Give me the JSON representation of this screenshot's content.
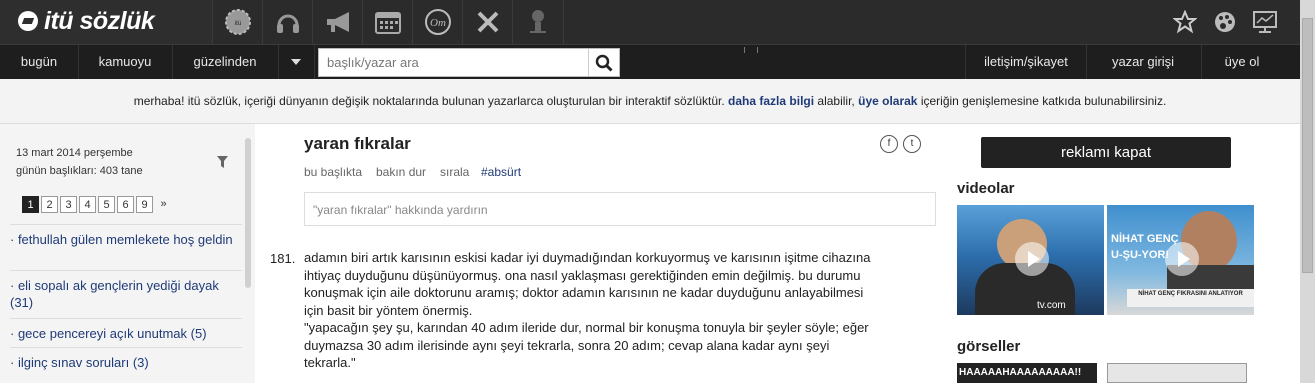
{
  "header": {
    "logo": "itü sözlük",
    "icons": [
      "badge-icon",
      "headphones-icon",
      "megaphone-icon",
      "calendar-icon",
      "om-icon",
      "tools-icon",
      "person-icon"
    ],
    "right_icons": [
      "star-icon",
      "palette-icon",
      "monitor-icon"
    ]
  },
  "nav": {
    "today": "bugün",
    "public_opinion": "kamuoyu",
    "from_pretty": "güzelinden",
    "contact": "iletişim/şikayet",
    "login": "yazar girişi",
    "register": "üye ol"
  },
  "search": {
    "placeholder": "başlık/yazar ara"
  },
  "info": {
    "pre": "merhaba! itü sözlük, içeriği dünyanın değişik noktalarında bulunan yazarlarca oluşturulan bir interaktif sözlüktür.",
    "link1": "daha fazla bilgi",
    "mid": "alabilir,",
    "link2": "üye olarak",
    "post": "içeriğin genişlemesine katkıda bulunabilirsiniz."
  },
  "sidebar": {
    "date": "13 mart 2014 perşembe",
    "count": "günün başlıkları: 403 tane",
    "pages": [
      "1",
      "2",
      "3",
      "4",
      "5",
      "6",
      "9",
      "»"
    ],
    "topics": [
      "· fethullah gülen memlekete hoş geldin",
      "· eli sopalı ak gençlerin yediği dayak (31)",
      "· gece pencereyi açık unutmak (5)",
      "· ilginç sınav soruları (3)"
    ]
  },
  "topic": {
    "title": "yaran fıkralar",
    "share": [
      "f",
      "t"
    ],
    "actions": [
      "bu başlıkta",
      "bakın dur",
      "sırala"
    ],
    "tag": "#absürt",
    "hint": "\"yaran fıkralar\" hakkında yardırın",
    "entry_no": "181.",
    "entry_lines": [
      "adamın biri artık karısının eskisi kadar iyi duymadığından korkuyormuş ve karısının işitme cihazına",
      "ihtiyaç duyduğunu düşünüyormuş. ona nasıl yaklaşması gerektiğinden emin değilmiş. bu durumu",
      "konuşmak için aile doktorunu aramış; doktor adamın karısının ne kadar duyduğunu anlayabilmesi",
      "için basit bir yöntem önermiş.",
      "\"yapacağın şey şu, karından 40 adım ileride dur, normal bir konuşma tonuyla bir şeyler söyle; eğer",
      "duymazsa 30 adım ilerisinde aynı şeyi tekrarla, sonra 20 adım; cevap alana kadar aynı şeyi",
      "tekrarla.\""
    ]
  },
  "right": {
    "ad_close": "reklamı kapat",
    "videos": "videolar",
    "video1_caption": "tv.com",
    "video2_top": "NİHAT GENÇ",
    "video2_mid": "U-ŞU-YOR!",
    "video2_caption": "NİHAT GENÇ FIKRASINI ANLATIYOR",
    "images": "görseller",
    "image1_text": "HAAAAAHAAAAAAAAA!!"
  },
  "colors": {
    "topbar": "#2b2b2b",
    "navbar": "#1e1e1e",
    "link": "#1f3a77"
  }
}
